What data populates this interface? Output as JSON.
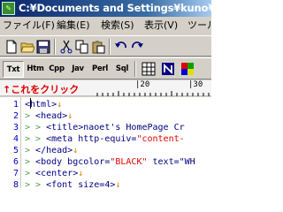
{
  "window": {
    "title": "C:¥Documents and Settings¥kuno¥デス"
  },
  "menu": {
    "items": [
      "ファイル(F)",
      "編集(E)",
      "検索(S)",
      "表示(V)",
      "ツール"
    ]
  },
  "toolbar": {
    "icons": [
      "new-file-icon",
      "open-folder-icon",
      "save-icon",
      "cut-icon",
      "copy-icon",
      "paste-icon",
      "undo-icon",
      "redo-icon"
    ]
  },
  "modes": {
    "buttons": [
      "Txt",
      "Htm",
      "Cpp",
      "Jav",
      "Perl",
      "Sql"
    ],
    "active": "Txt"
  },
  "ruler": {
    "annotation": "↑これをクリック",
    "marks": [
      "|20",
      "|30"
    ]
  },
  "editor": {
    "line_numbers": [
      "1",
      "2",
      "3",
      "4",
      "5",
      "6",
      "7",
      "8"
    ],
    "lines": [
      {
        "indent": "",
        "code": "<html>",
        "str": "",
        "rest": ""
      },
      {
        "indent": ">   ",
        "code": "<head>",
        "str": "",
        "rest": ""
      },
      {
        "indent": ">   >   ",
        "code": "<title>naoet's HomePage Cr",
        "str": "",
        "rest": ""
      },
      {
        "indent": ">   >   ",
        "code": "<meta http-equiv=",
        "str": "\"content-",
        "rest": ""
      },
      {
        "indent": ">   ",
        "code": "</head>",
        "str": "",
        "rest": ""
      },
      {
        "indent": ">   ",
        "code": "<body bgcolor=",
        "str": "\"BLACK\"",
        "rest": " text=\"WH"
      },
      {
        "indent": ">   ",
        "code": "<center>",
        "str": "",
        "rest": ""
      },
      {
        "indent": ">   >   ",
        "code": "<font size=4>",
        "str": "",
        "rest": ""
      }
    ],
    "eol_mark": "↓"
  },
  "colors": {
    "title_gradient_start": "#0a246a",
    "line_number": "#0000cc",
    "annotation": "#e00000",
    "eol": "#e08000"
  }
}
